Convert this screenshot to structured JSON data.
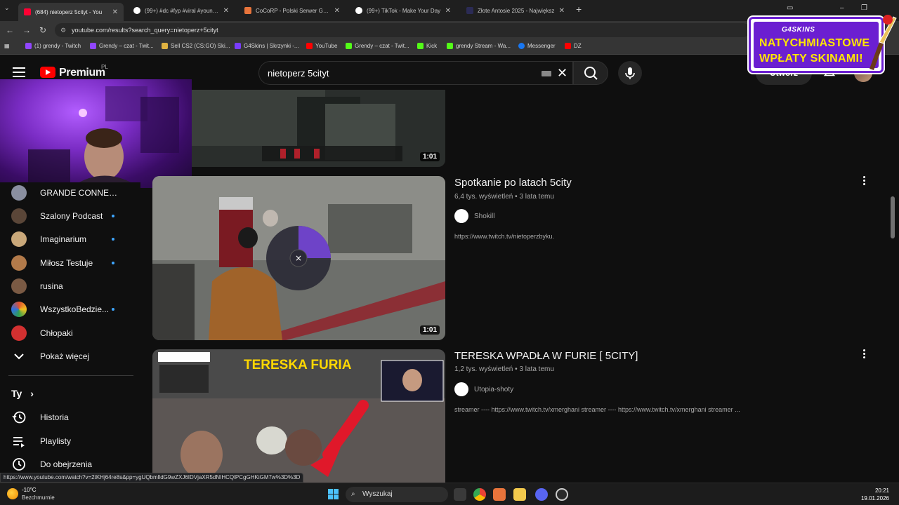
{
  "browser": {
    "tabs": [
      {
        "label": "(684) nietoperz 5cityt - You",
        "active": true,
        "favicon_color": "#ff0033"
      },
      {
        "label": "(99+) #dc #fyp #viral #youngm",
        "active": false,
        "favicon_color": "#ffffff"
      },
      {
        "label": "CoCoRP - Polski Serwer GTA RP",
        "active": false,
        "favicon_color": "#e8743b"
      },
      {
        "label": "(99+) TikTok - Make Your Day",
        "active": false,
        "favicon_color": "#ffffff"
      },
      {
        "label": "Złote Antosie 2025 - Największ",
        "active": false,
        "favicon_color": "#2b2b55"
      }
    ],
    "new_tab": "+",
    "url": "youtube.com/results?search_query=nietoperz+5cityt",
    "bookmarks": [
      {
        "label": "(1) grendy - Twitch",
        "color": "#9146ff"
      },
      {
        "label": "Grendy – czat - Twit...",
        "color": "#9146ff"
      },
      {
        "label": "Sell CS2 (CS:GO) Ski...",
        "color": "#e0b341"
      },
      {
        "label": "G4Skins | Skrzynki -...",
        "color": "#7a3cff"
      },
      {
        "label": "YouTube",
        "color": "#ff0000"
      },
      {
        "label": "Grendy – czat - Twit...",
        "color": "#53fc18"
      },
      {
        "label": "Kick",
        "color": "#53fc18"
      },
      {
        "label": "grendy Stream - Wa...",
        "color": "#53fc18"
      },
      {
        "label": "Messenger",
        "color": "#1877f2"
      },
      {
        "label": "DZ",
        "color": "#ff0000"
      }
    ]
  },
  "youtube": {
    "logo_text": "Premium",
    "region": "PL",
    "search_value": "nietoperz 5cityt",
    "create_label": "Utwórz"
  },
  "ad": {
    "brand": "G4SKINS",
    "line1": "NATYCHMIASTOWE",
    "line2": "WPŁATY SKINAMI!"
  },
  "sidebar": {
    "subscriptions": [
      {
        "name": "GRANDE CONNECT...",
        "new": false,
        "color": "#8a8fa0"
      },
      {
        "name": "Szalony Podcast",
        "new": true,
        "color": "#5a4638"
      },
      {
        "name": "Imaginarium",
        "new": true,
        "color": "#c9a87a"
      },
      {
        "name": "Miłosz Testuje",
        "new": true,
        "color": "#b27a4a"
      },
      {
        "name": "rusina",
        "new": false,
        "color": "#7a5a44"
      },
      {
        "name": "WszystkoBedzie...",
        "new": true,
        "color": "#e05030"
      },
      {
        "name": "Chłopaki",
        "new": false,
        "color": "#d23030"
      }
    ],
    "show_more": "Pokaż więcej",
    "you_label": "Ty",
    "you_chevron": "›",
    "you_items": [
      {
        "label": "Historia",
        "icon": "history-icon"
      },
      {
        "label": "Playlisty",
        "icon": "playlist-icon"
      },
      {
        "label": "Do obejrzenia",
        "icon": "clock-icon"
      }
    ]
  },
  "videos": [
    {
      "title": "",
      "duration": "1:01"
    },
    {
      "title": "Spotkanie po latach 5city",
      "views": "6,4 tys. wyświetleń",
      "age": "3 lata temu",
      "channel": "Shokill",
      "description": "https://www.twitch.tv/nietoperzbyku.",
      "duration": "1:01"
    },
    {
      "title": "TERESKA WPADŁA W FURIE [ 5CITY]",
      "views": "1,2 tys. wyświetleń",
      "age": "3 lata temu",
      "channel": "Utopia-shoty",
      "description": "streamer ---- https://www.twitch.tv/xmerghani streamer ---- https://www.twitch.tv/xmerghani streamer ...",
      "thumb_text": "TERESKA FURIA"
    }
  ],
  "status_url": "https://www.youtube.com/watch?v=2tKHj64re8s&pp=ygUQbmlldG9wZXJ6IDVjaXR5dNIHCQlPCgGHKiGM7w%3D%3D",
  "taskbar": {
    "temperature": "-10°C",
    "weather": "Bezchmurnie",
    "search_label": "Wyszukaj",
    "time": "20:21",
    "date": "19.01.2026"
  }
}
